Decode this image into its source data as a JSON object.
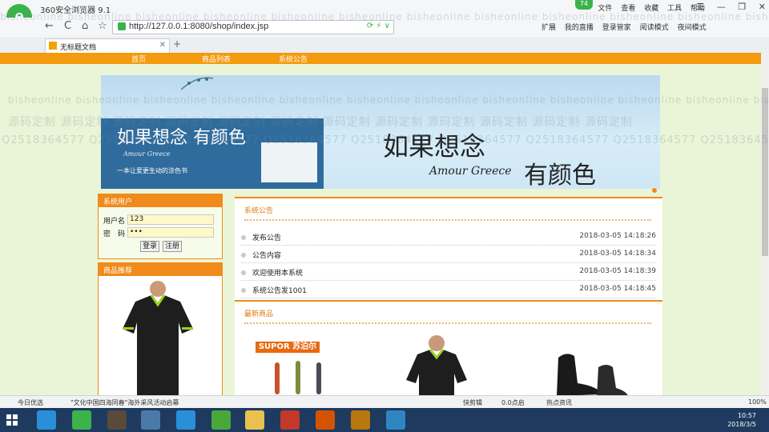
{
  "browser": {
    "app_title": "360安全浏览器 9.1",
    "logo_letter": "e",
    "menu": [
      "文件",
      "查看",
      "收藏",
      "工具",
      "帮助"
    ],
    "user_badge": "74",
    "window_controls": [
      "☰",
      "—",
      "❐",
      "✕"
    ],
    "nav_buttons": [
      "←",
      "C",
      "⌂",
      "☆"
    ],
    "address": "http://127.0.0.1:8080/shop/index.jsp",
    "address_icons": "⟳ ⚡ ∨",
    "tools_right": [
      "扩展",
      "我的直播",
      "登录管家",
      "阅读模式",
      "夜间模式"
    ],
    "tab_label": "无标题文档",
    "tab_close": "✕",
    "new_tab": "+"
  },
  "site": {
    "nav": [
      "首页",
      "商品列表",
      "系统公告"
    ],
    "banner": {
      "cover_title": "如果想念 有颜色",
      "cover_sub": "Amour Greece",
      "cover_line": "一本让爱更生动的涂色书",
      "title1": "如果想念",
      "sub": "Amour Greece",
      "title2": "有颜色"
    },
    "login": {
      "heading": "系统用户",
      "user_label": "用户名",
      "user_value": "123",
      "pass_label": "密　码",
      "pass_value": "•••",
      "login_btn": "登录",
      "register_btn": "注册"
    },
    "recommend_heading": "商品推荐",
    "announcements": {
      "heading": "系统公告",
      "items": [
        {
          "title": "发布公告",
          "date": "2018-03-05 14:18:26"
        },
        {
          "title": "公告内容",
          "date": "2018-03-05 14:18:34"
        },
        {
          "title": "欢迎使用本系统",
          "date": "2018-03-05 14:18:39"
        },
        {
          "title": "系统公告发1001",
          "date": "2018-03-05 14:18:45"
        }
      ]
    },
    "new_products": {
      "heading": "最新商品",
      "brand": "SUPOR 苏泊尔"
    }
  },
  "statusbar": {
    "left": "今日优选",
    "news": "\"文化中国四海同春\"海外采风活动启幕",
    "right": [
      "快剪辑",
      "0.0点启",
      "热点资讯"
    ],
    "zoom": "100%"
  },
  "taskbar": {
    "time": "10:57",
    "date": "2018/3/5"
  },
  "watermark": {
    "a": "bisheonline",
    "b": "源码定制",
    "c": "Q2518364577"
  }
}
